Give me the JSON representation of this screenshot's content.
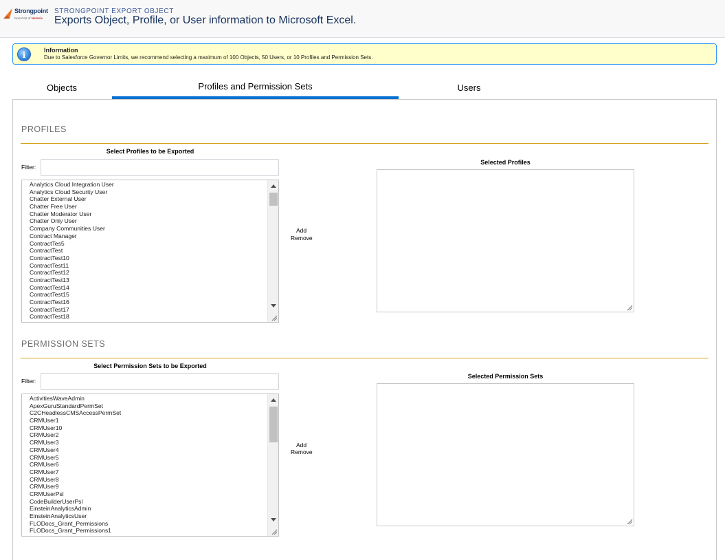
{
  "header": {
    "logo_name": "Strongpoint",
    "logo_tagline_prefix": "Now Part of",
    "logo_tagline_brand": "Netwrix",
    "subtitle": "STRONGPOINT EXPORT OBJECT",
    "title": "Exports Object, Profile, or User information to Microsoft Excel."
  },
  "info": {
    "icon": "info-icon",
    "title": "Information",
    "text": "Due to Salesforce Governor Limits, we recommend selecting a maximum of 100 Objects, 50 Users, or 10 Profiles and Permission Sets."
  },
  "tabs": {
    "objects": "Objects",
    "profiles": "Profiles and Permission Sets",
    "users": "Users",
    "active": "profiles",
    "active_color": "#0070d2"
  },
  "profiles": {
    "section_title": "PROFILES",
    "available_heading": "Select Profiles to be Exported",
    "filter_label": "Filter:",
    "filter_value": "",
    "selected_heading": "Selected Profiles",
    "add_label": "Add",
    "remove_label": "Remove",
    "items": [
      "Analytics Cloud Integration User",
      "Analytics Cloud Security User",
      "Chatter External User",
      "Chatter Free User",
      "Chatter Moderator User",
      "Chatter Only User",
      "Company Communities User",
      "Contract Manager",
      "ContractTes5",
      "ContractTest",
      "ContractTest10",
      "ContractTest11",
      "ContractTest12",
      "ContractTest13",
      "ContractTest14",
      "ContractTest15",
      "ContractTest16",
      "ContractTest17",
      "ContractTest18"
    ],
    "selected_items": []
  },
  "permission_sets": {
    "section_title": "PERMISSION SETS",
    "available_heading": "Select Permission Sets to be Exported",
    "filter_label": "Filter:",
    "filter_value": "",
    "selected_heading": "Selected Permission Sets",
    "add_label": "Add",
    "remove_label": "Remove",
    "items": [
      "ActivitiesWaveAdmin",
      "ApexGuruStandardPermSet",
      "C2CHeadlessCMSAccessPermSet",
      "CRMUser1",
      "CRMUser10",
      "CRMUser2",
      "CRMUser3",
      "CRMUser4",
      "CRMUser5",
      "CRMUser6",
      "CRMUser7",
      "CRMUser8",
      "CRMUser9",
      "CRMUserPsl",
      "CodeBuilderUserPsl",
      "EinsteinAnalyticsAdmin",
      "EinsteinAnalyticsUser",
      "FLODocs_Grant_Permissions",
      "FLODocs_Grant_Permissions1"
    ],
    "selected_items": []
  },
  "colors": {
    "section_rule": "#d4a017",
    "info_background": "#ffffcc",
    "info_border": "#3399ff"
  }
}
